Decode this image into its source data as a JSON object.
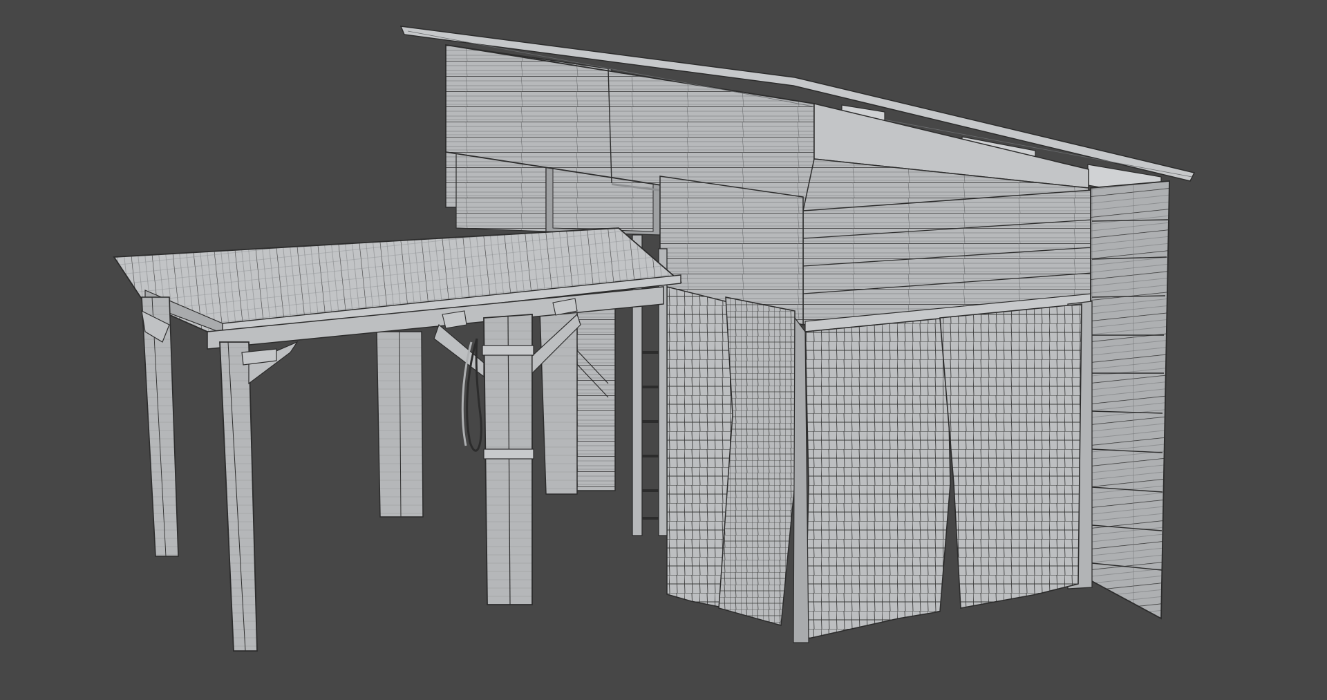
{
  "scene": {
    "background_color": "#474747",
    "model_fill_color": "#b9bbbd",
    "model_shade_color": "#9c9ea1",
    "model_light_color": "#cfd1d3",
    "wire_color": "#3a3a3a",
    "edge_color": "#2c2c2c",
    "icons": [
      "shed-model",
      "pergola-model",
      "curtain-cloth",
      "ladder",
      "rope-coil"
    ]
  }
}
